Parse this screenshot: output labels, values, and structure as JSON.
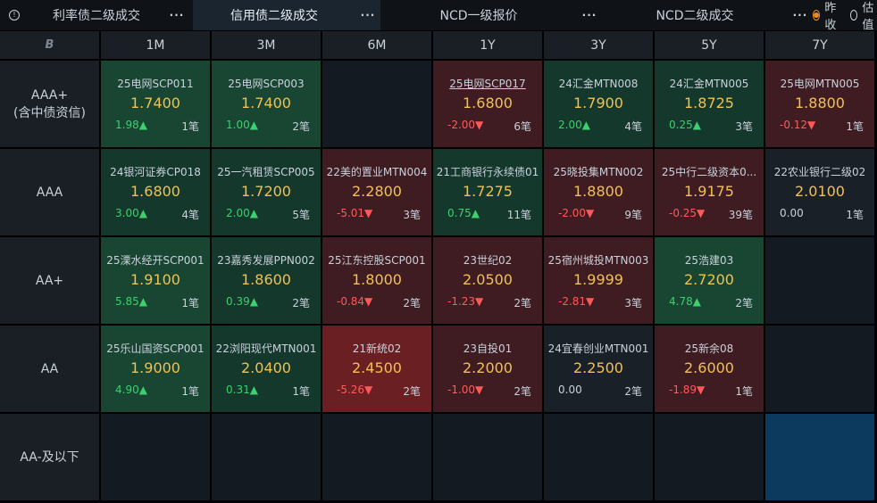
{
  "tabs": [
    {
      "label": "利率债二级成交",
      "dots": "···"
    },
    {
      "label": "信用债二级成交",
      "dots": "···"
    },
    {
      "label": "NCD一级报价",
      "dots": "···"
    },
    {
      "label": "NCD二级成交",
      "dots": "···"
    }
  ],
  "radios": [
    {
      "label": "昨收",
      "selected": true
    },
    {
      "label": "估值",
      "selected": false
    }
  ],
  "corner_glyph": "B",
  "columns": [
    "1M",
    "3M",
    "6M",
    "1Y",
    "3Y",
    "5Y",
    "7Y"
  ],
  "rows": [
    {
      "label_line1": "AAA+",
      "label_line2": "(含中债资信)"
    },
    {
      "label_line1": "AAA",
      "label_line2": ""
    },
    {
      "label_line1": "AA+",
      "label_line2": ""
    },
    {
      "label_line1": "AA",
      "label_line2": ""
    },
    {
      "label_line1": "AA-及以下",
      "label_line2": ""
    }
  ],
  "cells": [
    [
      {
        "name": "25电网SCP011",
        "yield": "1.7400",
        "change": "1.98▲",
        "count": "1笔"
      },
      {
        "name": "25电网SCP003",
        "yield": "1.7400",
        "change": "1.00▲",
        "count": "2笔"
      },
      null,
      {
        "name": "25电网SCP017",
        "yield": "1.6800",
        "change": "-2.00▼",
        "count": "6笔"
      },
      {
        "name": "24汇金MTN008",
        "yield": "1.7900",
        "change": "2.00▲",
        "count": "4笔"
      },
      {
        "name": "24汇金MTN005",
        "yield": "1.8725",
        "change": "0.25▲",
        "count": "3笔"
      },
      {
        "name": "25电网MTN005",
        "yield": "1.8800",
        "change": "-0.12▼",
        "count": "1笔"
      }
    ],
    [
      {
        "name": "24银河证券CP018",
        "yield": "1.6800",
        "change": "3.00▲",
        "count": "4笔"
      },
      {
        "name": "25一汽租赁SCP005",
        "yield": "1.7200",
        "change": "2.00▲",
        "count": "5笔"
      },
      {
        "name": "22美的置业MTN004",
        "yield": "2.2800",
        "change": "-5.01▼",
        "count": "3笔"
      },
      {
        "name": "21工商银行永续债01",
        "yield": "1.7275",
        "change": "0.75▲",
        "count": "11笔"
      },
      {
        "name": "25晓投集MTN002",
        "yield": "1.8800",
        "change": "-2.00▼",
        "count": "9笔"
      },
      {
        "name": "25中行二级资本0...",
        "yield": "1.9175",
        "change": "-0.25▼",
        "count": "39笔"
      },
      {
        "name": "22农业银行二级02",
        "yield": "2.0100",
        "change": "0.00",
        "count": "1笔"
      }
    ],
    [
      {
        "name": "25溧水经开SCP001",
        "yield": "1.9100",
        "change": "5.85▲",
        "count": "1笔"
      },
      {
        "name": "23嘉秀发展PPN002",
        "yield": "1.8600",
        "change": "0.39▲",
        "count": "2笔"
      },
      {
        "name": "25江东控股SCP001",
        "yield": "1.8000",
        "change": "-0.84▼",
        "count": "2笔"
      },
      {
        "name": "23世纪02",
        "yield": "2.0500",
        "change": "-1.23▼",
        "count": "2笔"
      },
      {
        "name": "25宿州城投MTN003",
        "yield": "1.9999",
        "change": "-2.81▼",
        "count": "3笔"
      },
      {
        "name": "25浩建03",
        "yield": "2.7200",
        "change": "4.78▲",
        "count": "2笔"
      },
      null
    ],
    [
      {
        "name": "25乐山国资SCP001",
        "yield": "1.9000",
        "change": "4.90▲",
        "count": "1笔"
      },
      {
        "name": "22浏阳现代MTN001",
        "yield": "2.0400",
        "change": "0.31▲",
        "count": "1笔"
      },
      {
        "name": "21新统02",
        "yield": "2.4500",
        "change": "-5.26▼",
        "count": "2笔"
      },
      {
        "name": "23自投01",
        "yield": "2.2000",
        "change": "-1.00▼",
        "count": "2笔"
      },
      {
        "name": "24宜春创业MTN001",
        "yield": "2.2500",
        "change": "0.00",
        "count": "2笔"
      },
      {
        "name": "25新余08",
        "yield": "2.6000",
        "change": "-1.89▼",
        "count": "1笔"
      },
      null
    ],
    [
      null,
      null,
      null,
      null,
      null,
      null,
      null
    ]
  ],
  "colors": {
    "up": "#3ecf6e",
    "down": "#ff5a5a",
    "yield": "#f2c14e",
    "accent": "#e98a2c",
    "green_strong": "#184633",
    "green_soft": "#15382d",
    "red_soft": "#3e1c22",
    "red_strong": "#6a1f23",
    "neutral": "#1a2028",
    "highlight_blue": "#0c3a5e"
  }
}
